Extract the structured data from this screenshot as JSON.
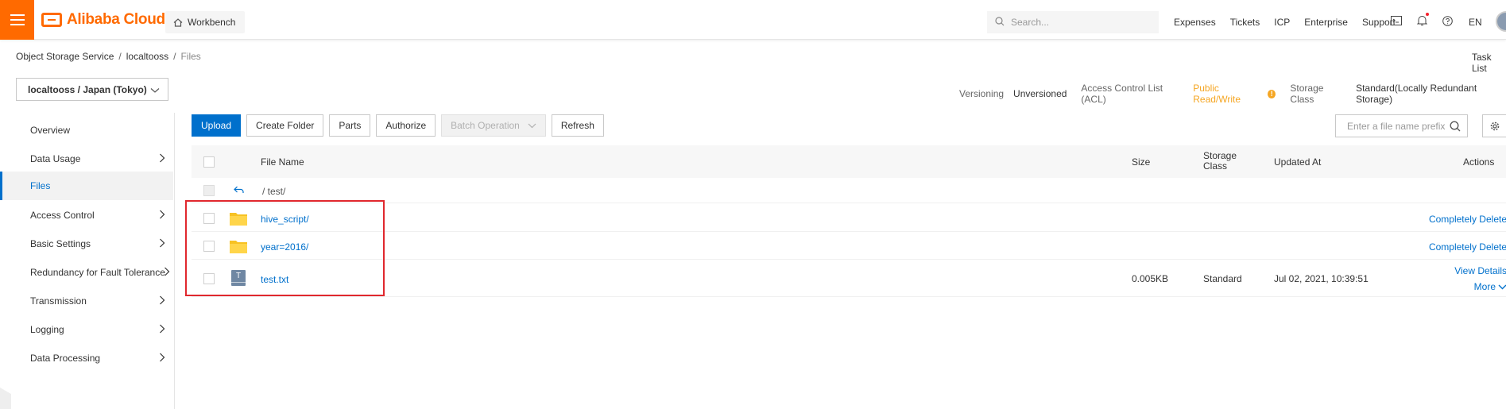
{
  "topbar": {
    "logo_text": "Alibaba Cloud",
    "workbench_label": "Workbench",
    "search_placeholder": "Search...",
    "nav": [
      "Expenses",
      "Tickets",
      "ICP",
      "Enterprise",
      "Support"
    ],
    "language": "EN",
    "brand_color": "#ff6a00"
  },
  "breadcrumb": {
    "items": [
      "Object Storage Service",
      "localtooss",
      "Files"
    ],
    "separator": "/"
  },
  "task_list_label": "Task List",
  "bucket": {
    "selector_label": "localtooss / Japan (Tokyo)",
    "versioning_label": "Versioning",
    "versioning_value": "Unversioned",
    "acl_label": "Access Control List (ACL)",
    "acl_value": "Public Read/Write",
    "acl_warning_icon": "!",
    "storage_class_label": "Storage Class",
    "storage_class_value": "Standard(Locally Redundant Storage)"
  },
  "sidebar": {
    "items": [
      {
        "label": "Overview",
        "has_arrow": false
      },
      {
        "label": "Data Usage",
        "has_arrow": true
      },
      {
        "label": "Files",
        "has_arrow": false,
        "active": true
      },
      {
        "label": "Access Control",
        "has_arrow": true
      },
      {
        "label": "Basic Settings",
        "has_arrow": true
      },
      {
        "label": "Redundancy for Fault Tolerance",
        "has_arrow": true
      },
      {
        "label": "Transmission",
        "has_arrow": true
      },
      {
        "label": "Logging",
        "has_arrow": true
      },
      {
        "label": "Data Processing",
        "has_arrow": true
      }
    ]
  },
  "toolbar": {
    "upload": "Upload",
    "create_folder": "Create Folder",
    "parts": "Parts",
    "authorize": "Authorize",
    "batch_operation": "Batch Operation",
    "refresh": "Refresh",
    "filter_placeholder": "Enter a file name prefix"
  },
  "table": {
    "headers": {
      "file_name": "File Name",
      "size": "Size",
      "storage_class": "Storage Class",
      "updated_at": "Updated At",
      "actions": "Actions"
    },
    "parent_path": "/ test/",
    "rows": [
      {
        "name": "hive_script/",
        "type": "folder",
        "size": "",
        "storage_class": "",
        "updated_at": "",
        "action": "Completely Delete"
      },
      {
        "name": "year=2016/",
        "type": "folder",
        "size": "",
        "storage_class": "",
        "updated_at": "",
        "action": "Completely Delete"
      },
      {
        "name": "test.txt",
        "type": "file",
        "size": "0.005KB",
        "storage_class": "Standard",
        "updated_at": "Jul 02, 2021, 10:39:51",
        "action": "View Details",
        "action_more": "More"
      }
    ],
    "file_icon_letter": "T"
  },
  "colors": {
    "primary": "#0070cc",
    "warning": "#f5a623",
    "highlight_box": "#e0282e",
    "folder": "#f7c223"
  }
}
